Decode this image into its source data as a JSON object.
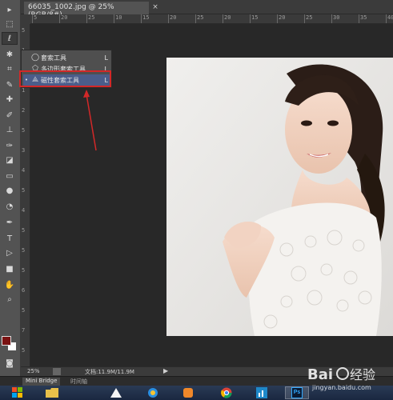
{
  "document": {
    "tab_title": "66035_1002.jpg @ 25%(RGB/8#)",
    "close_glyph": "×"
  },
  "rulers": {
    "top_ticks": [
      "5",
      "20",
      "25",
      "10",
      "15",
      "20",
      "25",
      "20",
      "15",
      "20",
      "25",
      "30",
      "35",
      "40"
    ],
    "left_ticks": [
      "5",
      "1",
      "5",
      "1",
      "2",
      "5",
      "3",
      "4",
      "5",
      "4",
      "5",
      "5",
      "5",
      "6",
      "5",
      "7",
      "5"
    ]
  },
  "toolbar": {
    "tools": [
      {
        "name": "move-tool",
        "glyph": "▸",
        "active": false
      },
      {
        "name": "marquee-tool",
        "glyph": "⬚",
        "active": false
      },
      {
        "name": "lasso-tool",
        "glyph": "ℓ",
        "active": true
      },
      {
        "name": "quick-select-tool",
        "glyph": "✱",
        "active": false
      },
      {
        "name": "crop-tool",
        "glyph": "⌗",
        "active": false
      },
      {
        "name": "eyedropper-tool",
        "glyph": "✎",
        "active": false
      },
      {
        "name": "healing-tool",
        "glyph": "✚",
        "active": false
      },
      {
        "name": "brush-tool",
        "glyph": "✐",
        "active": false
      },
      {
        "name": "stamp-tool",
        "glyph": "⊥",
        "active": false
      },
      {
        "name": "history-brush-tool",
        "glyph": "✑",
        "active": false
      },
      {
        "name": "eraser-tool",
        "glyph": "◪",
        "active": false
      },
      {
        "name": "gradient-tool",
        "glyph": "▭",
        "active": false
      },
      {
        "name": "blur-tool",
        "glyph": "●",
        "active": false
      },
      {
        "name": "dodge-tool",
        "glyph": "◔",
        "active": false
      },
      {
        "name": "pen-tool",
        "glyph": "✒",
        "active": false
      },
      {
        "name": "type-tool",
        "glyph": "T",
        "active": false
      },
      {
        "name": "path-select-tool",
        "glyph": "▷",
        "active": false
      },
      {
        "name": "shape-tool",
        "glyph": "■",
        "active": false
      },
      {
        "name": "hand-tool",
        "glyph": "✋",
        "active": false
      },
      {
        "name": "zoom-tool",
        "glyph": "⌕",
        "active": false
      }
    ],
    "foreground_color": "#7a1212",
    "background_color": "#ffffff"
  },
  "flyout": {
    "items": [
      {
        "icon": "lasso-icon",
        "glyph": "◯",
        "label": "套索工具",
        "shortcut": "L",
        "selected": false,
        "current": false
      },
      {
        "icon": "polygonal-lasso-icon",
        "glyph": "⬠",
        "label": "多边形套索工具",
        "shortcut": "L",
        "selected": false,
        "current": false
      },
      {
        "icon": "magnetic-lasso-icon",
        "glyph": "⟁",
        "label": "磁性套索工具",
        "shortcut": "L",
        "selected": true,
        "current": true
      }
    ]
  },
  "status": {
    "zoom": "25%",
    "doc_size": "文档:11.9M/11.9M",
    "arrow": "▶"
  },
  "panels": {
    "mini_bridge": "Mini Bridge",
    "timeline": "时间轴"
  },
  "taskbar": {
    "ps_label": "Ps"
  },
  "colors": {
    "highlight_red": "#d32828",
    "selected_blue": "#4b5d8a"
  }
}
